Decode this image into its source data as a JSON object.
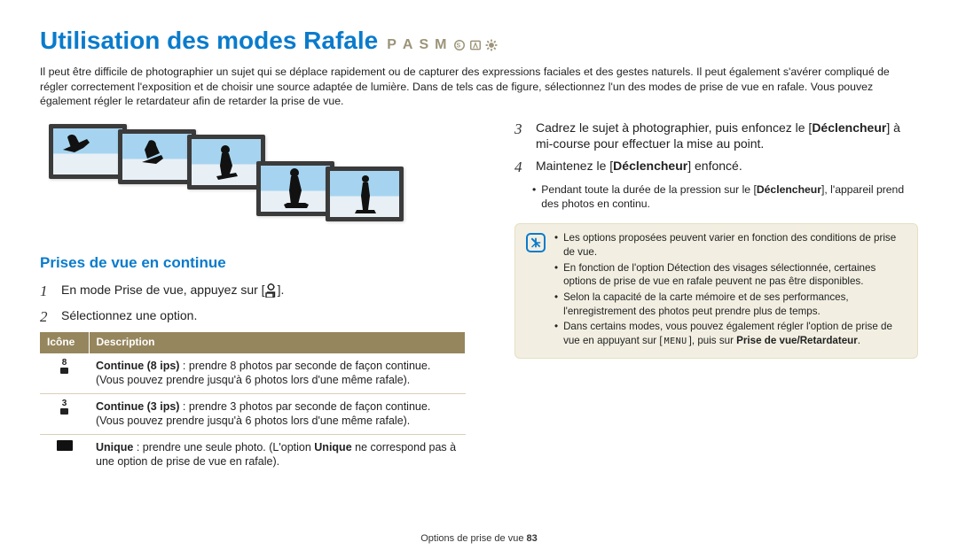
{
  "title": "Utilisation des modes Rafale",
  "modes": [
    "P",
    "A",
    "S",
    "M"
  ],
  "intro": "Il peut être difficile de photographier un sujet qui se déplace rapidement ou de capturer des expressions faciales et des gestes naturels. Il peut également s'avérer compliqué de régler correctement l'exposition et de choisir une source adaptée de lumière. Dans de tels cas de figure, sélectionnez l'un des modes de prise de vue en rafale. Vous pouvez également régler le retardateur afin de retarder la prise de vue.",
  "subhead": "Prises de vue en continue",
  "steps": {
    "s1": "En mode Prise de vue, appuyez sur [",
    "s1_after": "].",
    "s2": "Sélectionnez une option.",
    "s3_a": "Cadrez le sujet à photographier, puis enfoncez le [",
    "s3_b": "Déclencheur",
    "s3_c": "] à mi-course pour effectuer la mise au point.",
    "s4_a": "Maintenez le [",
    "s4_b": "Déclencheur",
    "s4_c": "] enfoncé.",
    "s4_sub_a": "Pendant toute la durée de la pression sur le [",
    "s4_sub_b": "Déclencheur",
    "s4_sub_c": "], l'appareil prend des photos en continu."
  },
  "table": {
    "h1": "Icône",
    "h2": "Description",
    "rows": [
      {
        "label": "8",
        "bold": "Continue (8 ips)",
        "rest": " : prendre 8 photos par seconde de façon continue. (Vous pouvez prendre jusqu'à 6 photos lors d'une même rafale)."
      },
      {
        "label": "3",
        "bold": "Continue (3 ips)",
        "rest": " : prendre 3 photos par seconde de façon continue. (Vous pouvez prendre jusqu'à 6 photos lors d'une même rafale)."
      },
      {
        "label": "single",
        "bold": "Unique",
        "mid": " : prendre une seule photo. (L'option ",
        "bold2": "Unique",
        "rest2": " ne correspond pas à une option de prise de vue en rafale)."
      }
    ]
  },
  "notes": [
    "Les options proposées peuvent varier en fonction des conditions de prise de vue.",
    "En fonction de l'option Détection des visages sélectionnée, certaines options de prise de vue en rafale peuvent ne pas être disponibles.",
    "Selon la capacité de la carte mémoire et de ses performances, l'enregistrement des photos peut prendre plus de temps."
  ],
  "note4_a": "Dans certains modes, vous pouvez également régler l'option de prise de vue en appuyant sur [",
  "note4_menu": "MENU",
  "note4_b": "], puis sur ",
  "note4_bold": "Prise de vue/Retardateur",
  "note4_c": ".",
  "footer_a": "Options de prise de vue  ",
  "footer_b": "83"
}
